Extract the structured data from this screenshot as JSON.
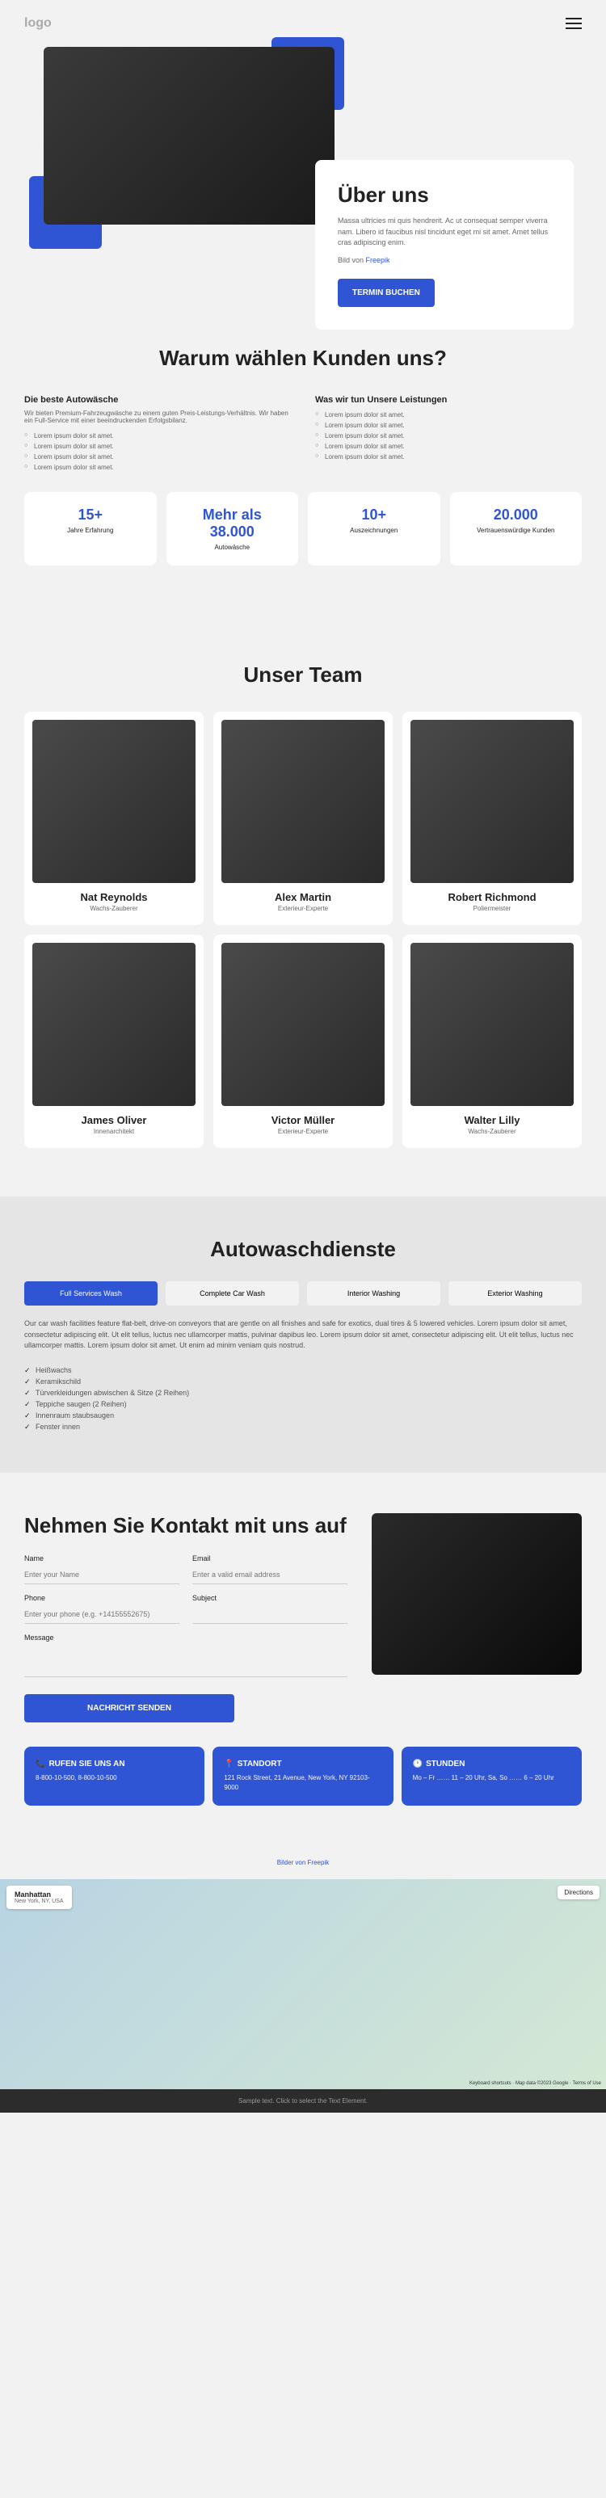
{
  "header": {
    "logo": "logo"
  },
  "hero": {
    "title": "Über uns",
    "desc": "Massa ultricies mi quis hendrerit. Ac ut consequat semper viverra nam. Libero id faucibus nisl tincidunt eget mi sit amet. Amet tellus cras adipiscing enim.",
    "attr_prefix": "Bild von ",
    "attr_link": "Freepik",
    "cta": "TERMIN BUCHEN"
  },
  "why": {
    "heading": "Warum wählen Kunden uns?",
    "col1": {
      "title": "Die beste Autowäsche",
      "text": "Wir bieten Premium-Fahrzeugwäsche zu einem guten Preis-Leistungs-Verhältnis. Wir haben ein Full-Service mit einer beeindruckenden Erfolgsbilanz.",
      "items": [
        "Lorem ipsum dolor sit amet.",
        "Lorem ipsum dolor sit amet.",
        "Lorem ipsum dolor sit amet.",
        "Lorem ipsum dolor sit amet."
      ]
    },
    "col2": {
      "title": "Was wir tun Unsere Leistungen",
      "text": "",
      "items": [
        "Lorem ipsum dolor sit amet.",
        "Lorem ipsum dolor sit amet.",
        "Lorem ipsum dolor sit amet.",
        "Lorem ipsum dolor sit amet.",
        "Lorem ipsum dolor sit amet."
      ]
    },
    "stats": [
      {
        "num": "15+",
        "label": "Jahre Erfahrung"
      },
      {
        "num": "Mehr als 38.000",
        "label": "Autowäsche"
      },
      {
        "num": "10+",
        "label": "Auszeichnungen"
      },
      {
        "num": "20.000",
        "label": "Vertrauenswürdige Kunden"
      }
    ]
  },
  "team": {
    "heading": "Unser Team",
    "members": [
      {
        "name": "Nat Reynolds",
        "role": "Wachs-Zauberer"
      },
      {
        "name": "Alex Martin",
        "role": "Exterieur-Experte"
      },
      {
        "name": "Robert Richmond",
        "role": "Poliermeister"
      },
      {
        "name": "James Oliver",
        "role": "Innenarchitekt"
      },
      {
        "name": "Victor Müller",
        "role": "Exterieur-Experte"
      },
      {
        "name": "Walter Lilly",
        "role": "Wachs-Zauberer"
      }
    ]
  },
  "services": {
    "heading": "Autowaschdienste",
    "tabs": [
      "Full Services Wash",
      "Complete Car Wash",
      "Interior Washing",
      "Exterior Washing"
    ],
    "desc": "Our car wash facilities feature flat-belt, drive-on conveyors that are gentle on all finishes and safe for exotics, dual tires & 5 lowered vehicles. Lorem ipsum dolor sit amet, consectetur adipiscing elit. Ut elit tellus, luctus nec ullamcorper mattis, pulvinar dapibus leo. Lorem ipsum dolor sit amet, consectetur adipiscing elit. Ut elit tellus, luctus nec ullamcorper mattis. Lorem ipsum dolor sit amet. Ut enim ad minim veniam quis nostrud.",
    "items": [
      "Heißwachs",
      "Keramikschild",
      "Türverkleidungen abwischen & Sitze (2 Reihen)",
      "Teppiche saugen (2 Reihen)",
      "Innenraum staubsaugen",
      "Fenster innen"
    ]
  },
  "contact": {
    "heading": "Nehmen Sie Kontakt mit uns auf",
    "labels": {
      "name": "Name",
      "email": "Email",
      "phone": "Phone",
      "subject": "Subject",
      "message": "Message"
    },
    "placeholders": {
      "name": "Enter your Name",
      "email": "Enter a valid email address",
      "phone": "Enter your phone (e.g. +14155552675)"
    },
    "submit": "NACHRICHT SENDEN",
    "cards": [
      {
        "icon": "📞",
        "title": "RUFEN SIE UNS AN",
        "text": "8-800-10-500,\n8-800-10-500"
      },
      {
        "icon": "📍",
        "title": "STANDORT",
        "text": "121 Rock Street, 21 Avenue, New York, NY 92103-9000"
      },
      {
        "icon": "🕐",
        "title": "STUNDEN",
        "text": "Mo – Fr …… 11 – 20 Uhr, Sa, So …… 6 – 20 Uhr"
      }
    ]
  },
  "footer": {
    "attr_prefix": "Bilder von ",
    "attr_link": "Freepik"
  },
  "map": {
    "label": "Manhattan",
    "sub": "New York, NY, USA",
    "ctrl": "Directions",
    "attrib": "Keyboard shortcuts · Map data ©2023 Google · Terms of Use"
  },
  "bottom": "Sample text. Click to select the Text Element."
}
